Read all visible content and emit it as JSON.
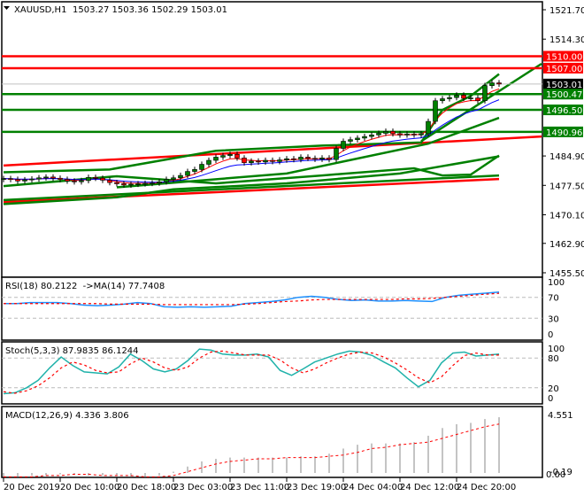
{
  "header": {
    "symbol": "XAUUSD,H1",
    "ohlc": "1503.27 1503.36 1502.29 1503.01"
  },
  "colors": {
    "bull": "#008000",
    "bear": "#ff0000",
    "level_red": "#ff0000",
    "level_green": "#008000",
    "ma_fast": "#ff0000",
    "ma_slow": "#0000ff",
    "rsi": "#1e90ff",
    "stoch_main": "#20b2aa",
    "signal": "#ff0000"
  },
  "chart_data": [
    {
      "type": "candlestick",
      "title": "XAUUSD,H1",
      "ylim": [
        1455.5,
        1521.7
      ],
      "y_ticks": [
        "1521.70",
        "1514.30",
        "1484.90",
        "1477.50",
        "1470.10",
        "1462.90",
        "1455.50"
      ],
      "x_tick_labels": [
        "20 Dec 2019",
        "20 Dec 10:00",
        "20 Dec 18:00",
        "23 Dec 03:00",
        "23 Dec 11:00",
        "23 Dec 19:00",
        "24 Dec 04:00",
        "24 Dec 12:00",
        "24 Dec 20:00"
      ],
      "closes": [
        1479.2,
        1479.0,
        1478.6,
        1478.9,
        1479.1,
        1479.4,
        1479.6,
        1479.3,
        1479.0,
        1478.6,
        1478.4,
        1478.7,
        1479.5,
        1479.3,
        1478.8,
        1478.2,
        1477.9,
        1477.6,
        1477.8,
        1477.9,
        1478.0,
        1478.1,
        1478.4,
        1479.0,
        1479.4,
        1480.0,
        1481.0,
        1481.5,
        1482.8,
        1483.8,
        1484.6,
        1485.0,
        1485.3,
        1484.4,
        1483.2,
        1483.6,
        1483.4,
        1483.8,
        1483.5,
        1483.9,
        1484.2,
        1484.0,
        1484.6,
        1484.3,
        1484.1,
        1484.4,
        1484.0,
        1486.8,
        1488.6,
        1489.0,
        1489.4,
        1489.8,
        1490.2,
        1490.6,
        1491.1,
        1490.5,
        1490.2,
        1490.4,
        1490.2,
        1490.5,
        1493.6,
        1498.8,
        1499.3,
        1499.6,
        1500.2,
        1499.4,
        1499.5,
        1498.8,
        1502.6,
        1503.3,
        1503.01
      ],
      "levels": [
        {
          "price": 1510.0,
          "label": "1510.00",
          "color": "#ff0000"
        },
        {
          "price": 1507.0,
          "label": "1507.00",
          "color": "#ff0000"
        },
        {
          "price": 1503.01,
          "label": "1503.01",
          "color": "#000000",
          "line": "#c0c0c0"
        },
        {
          "price": 1500.47,
          "label": "1500.47",
          "color": "#008000"
        },
        {
          "price": 1496.5,
          "label": "1496.50",
          "color": "#008000"
        },
        {
          "price": 1490.96,
          "label": "1490.96",
          "color": "#008000"
        }
      ],
      "overlays": [
        {
          "name": "red-channel-upper",
          "color": "#ff0000",
          "points": [
            [
              0,
              1482.5
            ],
            [
              76,
              1489.8
            ]
          ]
        },
        {
          "name": "red-channel-lower",
          "color": "#ff0000",
          "points": [
            [
              0,
              1473.3
            ],
            [
              70,
              1479.1
            ]
          ]
        },
        {
          "name": "green-channel-lower",
          "color": "#008000",
          "points": [
            [
              0,
              1473.8
            ],
            [
              70,
              1480.0
            ]
          ]
        },
        {
          "name": "green-trend-steep",
          "color": "#008000",
          "points": [
            [
              59,
              1488.6
            ],
            [
              76,
              1508.1
            ]
          ]
        },
        {
          "name": "green-trend-long",
          "color": "#008000",
          "points": [
            [
              16,
              1477.0
            ],
            [
              40,
              1480.5
            ],
            [
              60,
              1488.0
            ],
            [
              70,
              1494.5
            ]
          ]
        },
        {
          "name": "green-band-upper",
          "color": "#008000",
          "points": [
            [
              0,
              1480.8
            ],
            [
              15,
              1481.5
            ],
            [
              30,
              1486.2
            ],
            [
              45,
              1487.5
            ],
            [
              59,
              1488.3
            ],
            [
              62,
              1496.5
            ],
            [
              66,
              1500.0
            ],
            [
              70,
              1505.5
            ]
          ]
        },
        {
          "name": "green-band-mid",
          "color": "#008000",
          "points": [
            [
              0,
              1477.3
            ],
            [
              16,
              1479.8
            ],
            [
              30,
              1478.0
            ],
            [
              45,
              1480.0
            ],
            [
              58,
              1481.8
            ],
            [
              62,
              1480.0
            ],
            [
              66,
              1480.2
            ],
            [
              70,
              1485.0
            ]
          ]
        },
        {
          "name": "green-band-low",
          "color": "#008000",
          "points": [
            [
              0,
              1472.8
            ],
            [
              16,
              1474.5
            ],
            [
              24,
              1476.5
            ],
            [
              40,
              1478.0
            ],
            [
              56,
              1480.5
            ],
            [
              70,
              1484.8
            ]
          ]
        }
      ]
    },
    {
      "type": "line",
      "title": "RSI(18) 80.2122  ->MA(14) 77.7408",
      "ylim": [
        0,
        100
      ],
      "levels": [
        70,
        30
      ],
      "y_ticks": [
        "100",
        "70",
        "30",
        "0"
      ],
      "series": [
        {
          "name": "RSI(18)",
          "values": [
            58,
            58,
            60,
            60,
            60,
            58,
            55,
            54,
            55,
            57,
            60,
            58,
            52,
            51,
            52,
            51,
            52,
            53,
            58,
            60,
            62,
            65,
            70,
            72,
            70,
            66,
            64,
            65,
            63,
            63,
            64,
            63,
            62,
            70,
            74,
            76,
            78,
            80
          ]
        },
        {
          "name": "MA(14)",
          "values": [
            58,
            58,
            58,
            58,
            58,
            58,
            58,
            58,
            57,
            57,
            57,
            57,
            56,
            56,
            56,
            56,
            56,
            56,
            57,
            58,
            60,
            62,
            63,
            65,
            66,
            66,
            66,
            66,
            66,
            66,
            67,
            67,
            68,
            70,
            72,
            74,
            76,
            77.7
          ]
        }
      ]
    },
    {
      "type": "line",
      "title": "Stoch(5,3,3) 87.9835 86.1244",
      "ylim": [
        0,
        100
      ],
      "levels": [
        80,
        20
      ],
      "y_ticks": [
        "100",
        "80",
        "20",
        "0"
      ],
      "series": [
        {
          "name": "Main",
          "values": [
            8,
            10,
            20,
            35,
            60,
            82,
            65,
            52,
            50,
            48,
            62,
            88,
            75,
            58,
            52,
            58,
            75,
            98,
            96,
            88,
            86,
            86,
            88,
            82,
            55,
            45,
            58,
            72,
            80,
            88,
            94,
            92,
            85,
            72,
            60,
            40,
            22,
            35,
            70,
            90,
            92,
            84,
            86,
            88
          ]
        },
        {
          "name": "Signal",
          "values": [
            12,
            9,
            14,
            24,
            40,
            60,
            72,
            66,
            55,
            50,
            52,
            68,
            80,
            72,
            60,
            55,
            62,
            80,
            92,
            94,
            90,
            86,
            86,
            86,
            76,
            60,
            50,
            58,
            70,
            80,
            88,
            92,
            90,
            82,
            70,
            56,
            40,
            30,
            42,
            65,
            85,
            90,
            86,
            86
          ]
        }
      ]
    },
    {
      "type": "bar",
      "title": "MACD(12,26,9) 4.336 3.806",
      "ylim": [
        -0.19,
        4.551
      ],
      "y_ticks": [
        "4.551",
        "-0.19",
        "0.00"
      ],
      "series": [
        {
          "name": "MACD",
          "values": [
            -0.3,
            -0.3,
            -0.2,
            -0.2,
            -0.1,
            -0.1,
            -0.2,
            -0.2,
            -0.2,
            -0.3,
            -0.3,
            -0.2,
            0.1,
            0.5,
            0.9,
            1.1,
            1.2,
            1.2,
            1.2,
            1.2,
            1.2,
            1.3,
            1.3,
            1.5,
            1.9,
            2.2,
            2.3,
            2.3,
            2.3,
            2.4,
            2.9,
            3.5,
            3.8,
            3.9,
            4.2,
            4.34
          ]
        },
        {
          "name": "Signal",
          "values": [
            -0.3,
            -0.3,
            -0.3,
            -0.2,
            -0.2,
            -0.1,
            -0.1,
            -0.2,
            -0.2,
            -0.2,
            -0.3,
            -0.3,
            -0.2,
            0.1,
            0.4,
            0.7,
            0.9,
            1.0,
            1.1,
            1.1,
            1.2,
            1.2,
            1.2,
            1.3,
            1.4,
            1.6,
            1.9,
            2.0,
            2.2,
            2.3,
            2.4,
            2.7,
            3.0,
            3.3,
            3.6,
            3.81
          ]
        }
      ]
    }
  ]
}
